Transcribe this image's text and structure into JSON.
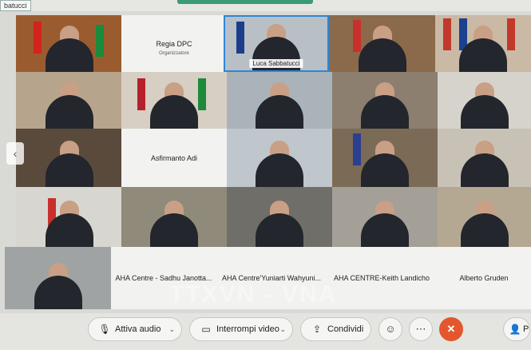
{
  "window": {
    "top_label": "batucci"
  },
  "participants": {
    "regia": {
      "name": "Regia DPC",
      "role": "Organizzatore"
    },
    "luca": {
      "name": "Luca Sabbatucci"
    },
    "asfirmanto": {
      "name": "Asfirmanto Adi"
    },
    "sadhu": {
      "name": "AHA Centre - Sadhu Janotta..."
    },
    "yuniarti": {
      "name": "AHA Centre'Yuniarti Wahyuni..."
    },
    "keith": {
      "name": "AHA CENTRE-Keith Landicho"
    },
    "alberto": {
      "name": "Alberto Gruden"
    }
  },
  "watermark": "TTXVN - VNA",
  "toolbar": {
    "audio_label": "Attiva audio",
    "video_label": "Interrompi video",
    "share_label": "Condividi",
    "people_label": "P"
  },
  "icons": {
    "mic": "mic-off-icon",
    "camera": "camera-icon",
    "share": "share-icon",
    "emoji": "emoji-icon",
    "more": "more-icon",
    "end": "end-call-icon",
    "people": "people-icon",
    "prev": "chevron-left-icon"
  },
  "colors": {
    "end_call": "#e4572e",
    "active_border": "#2e86d6",
    "accent_bar": "#3a9b76"
  }
}
